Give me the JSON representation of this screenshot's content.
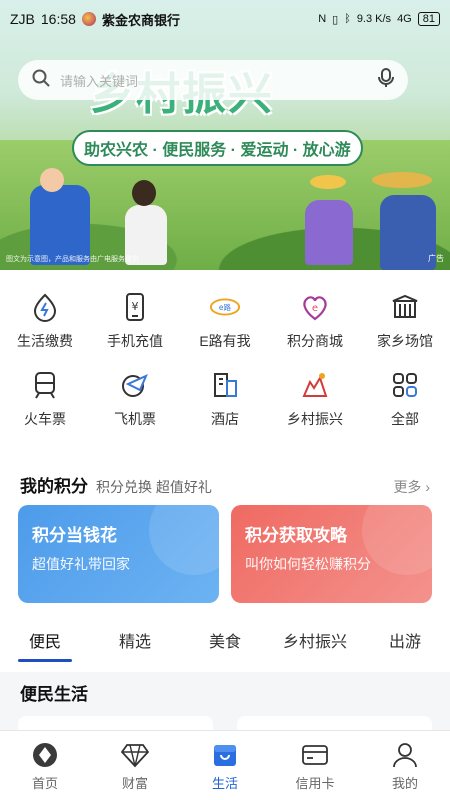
{
  "status_bar": {
    "left_text": "ZJB",
    "time": "16:58",
    "bank_name": "紫金农商银行",
    "network_speed": "9.3 K/s",
    "network": "4G",
    "battery": "81"
  },
  "banner": {
    "search_placeholder": "请输入关键词",
    "headline": "乡村振兴",
    "subline": "助农兴农 · 便民服务 · 爱运动 · 放心游",
    "disclaimer": "图文为示意图，产品和服务由广电服务提供",
    "ad_tag": "广告"
  },
  "services": [
    {
      "label": "生活缴费",
      "icon": "utility-payment-icon"
    },
    {
      "label": "手机充值",
      "icon": "phone-recharge-icon"
    },
    {
      "label": "E路有我",
      "icon": "e-road-icon"
    },
    {
      "label": "积分商城",
      "icon": "points-mall-icon"
    },
    {
      "label": "家乡场馆",
      "icon": "hometown-venue-icon"
    },
    {
      "label": "火车票",
      "icon": "train-ticket-icon"
    },
    {
      "label": "飞机票",
      "icon": "flight-ticket-icon"
    },
    {
      "label": "酒店",
      "icon": "hotel-icon"
    },
    {
      "label": "乡村振兴",
      "icon": "rural-revitalization-icon"
    },
    {
      "label": "全部",
      "icon": "all-services-icon"
    }
  ],
  "points": {
    "title": "我的积分",
    "subtitle": "积分兑换 超值好礼",
    "more": "更多",
    "cards": [
      {
        "title": "积分当钱花",
        "subtitle": "超值好礼带回家",
        "color": "#5aa6ef"
      },
      {
        "title": "积分获取攻略",
        "subtitle": "叫你如何轻松赚积分",
        "color": "#f17b73"
      }
    ]
  },
  "tabs": [
    {
      "label": "便民",
      "active": true
    },
    {
      "label": "精选",
      "active": false
    },
    {
      "label": "美食",
      "active": false
    },
    {
      "label": "乡村振兴",
      "active": false
    },
    {
      "label": "出游",
      "active": false
    }
  ],
  "section": {
    "title": "便民生活"
  },
  "bottom_nav": [
    {
      "label": "首页",
      "icon": "home-icon",
      "active": false
    },
    {
      "label": "财富",
      "icon": "diamond-icon",
      "active": false
    },
    {
      "label": "生活",
      "icon": "shop-icon",
      "active": true
    },
    {
      "label": "信用卡",
      "icon": "credit-card-icon",
      "active": false
    },
    {
      "label": "我的",
      "icon": "profile-icon",
      "active": false
    }
  ],
  "colors": {
    "accent": "#1f63d6",
    "green": "#3bb07a"
  }
}
